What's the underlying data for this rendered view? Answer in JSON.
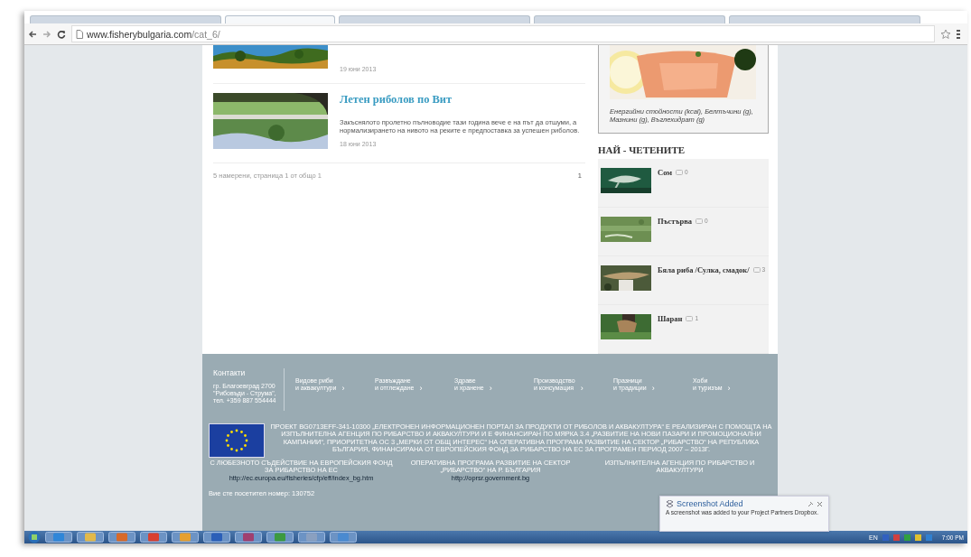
{
  "browser": {
    "tabs": [
      {
        "selected": false
      },
      {
        "selected": true
      },
      {
        "selected": false
      },
      {
        "selected": false
      },
      {
        "selected": false
      }
    ],
    "url_host": "www.fisherybulgaria.com",
    "url_path": "/cat_6/"
  },
  "articles": [
    {
      "date": "19 юни 2013"
    },
    {
      "title": "Летен риболов по Вит",
      "excerpt": "Закъснялото пролетно пълноводие тази година вече е на път да отшуми, а нормализирането на нивото на реките е предпоставка за успешен риболов.",
      "date": "18 юни 2013"
    }
  ],
  "pagination": {
    "summary": "5 намерени, страница 1 от общо 1",
    "pages": [
      "1"
    ]
  },
  "sidebar": {
    "recipe_caption": "Енергийни стойности (kcal), Белтъчини (g), Мазнини (g), Въглехидрат (g)",
    "heading": "НАЙ - ЧЕТЕНИТЕ",
    "most_read": [
      {
        "title": "Сом",
        "comments": "0"
      },
      {
        "title": "Пъстърва",
        "comments": "0"
      },
      {
        "title": "Бяла риба /Сулка, смадок/",
        "comments": "3"
      },
      {
        "title": "Шаран",
        "comments": "1"
      }
    ]
  },
  "footer": {
    "contacts_title": "Контакти",
    "contacts_lines": [
      "гр. Благоевград 2700",
      "\"Рибовъди - Струма\",",
      "тел. +359 887 554444"
    ],
    "nav": [
      {
        "lines": [
          "Видове риби",
          "и аквакултури"
        ],
        "arrow": "›"
      },
      {
        "lines": [
          "Развъждане",
          "и отглеждане"
        ],
        "arrow": "›"
      },
      {
        "lines": [
          "Здраве",
          "и хранене"
        ],
        "arrow": "›"
      },
      {
        "lines": [
          "Производство",
          "и консумация"
        ],
        "arrow": "›"
      },
      {
        "lines": [
          "Празници",
          "и традиции"
        ],
        "arrow": "›"
      },
      {
        "lines": [
          "Хоби",
          "и туризъм"
        ],
        "arrow": "›"
      }
    ],
    "project_text": "ПРОЕКТ BG0713EFF-341-10300 „ЕЛЕКТРОНЕН ИНФОРМАЦИОНЕН ПОРТАЛ ЗА ПРОДУКТИ ОТ РИБОЛОВ И АКВАКУЛТУРА“ Е РЕАЛИЗИРАН С ПОМОЩТА НА ИЗПЪЛНИТЕЛНА АГЕНЦИЯ ПО РИБАРСТВО И АКВАКУЛТУРИ И Е ФИНАНСИРАН ПО МЯРКА 3.4 „РАЗВИТИЕ НА НОВИ ПАЗАРИ И ПРОМОЦИОНАЛНИ КАМПАНИИ“, ПРИОРИТЕТНА ОС 3 „МЕРКИ ОТ ОБЩ ИНТЕРЕС“ НА ОПЕРАТИВНА ПРОГРАМА РАЗВИТИЕ НА СЕКТОР „РИБАРСТВО“ НА РЕПУБЛИКА БЪЛГАРИЯ, ФИНАНСИРАНА ОТ ЕВРОПЕЙСКИЯ ФОНД ЗА РИБАРСТВО НА ЕС ЗА ПРОГРАМЕН ПЕРИОД 2007 – 2013Г.",
    "partners": [
      {
        "text": "С ЛЮБЕЗНОТО СЪДЕЙСТВИЕ НА ЕВРОПЕЙСКИЯ ФОНД ЗА РИБАРСТВО НА ЕС",
        "link": "http://ec.europa.eu/fisheries/cfp/eff/index_bg.htm"
      },
      {
        "text": "ОПЕРАТИВНА ПРОГРАМА РАЗВИТИЕ НА СЕКТОР „РИБАРСТВО“ НА Р. БЪЛГАРИЯ",
        "link": "http://oprsr.government.bg"
      },
      {
        "text": "ИЗПЪЛНИТЕЛНА АГЕНЦИЯ ПО РИБАРСТВО И АКВАКУЛТУРИ"
      }
    ],
    "visitor": "Вие сте посетител номер: 130752"
  },
  "notification": {
    "title": "Screenshot Added",
    "body": "A screenshot was added to your Project Partners Dropbox."
  },
  "taskbar": {
    "language": "EN",
    "time": "7:00 PM"
  }
}
